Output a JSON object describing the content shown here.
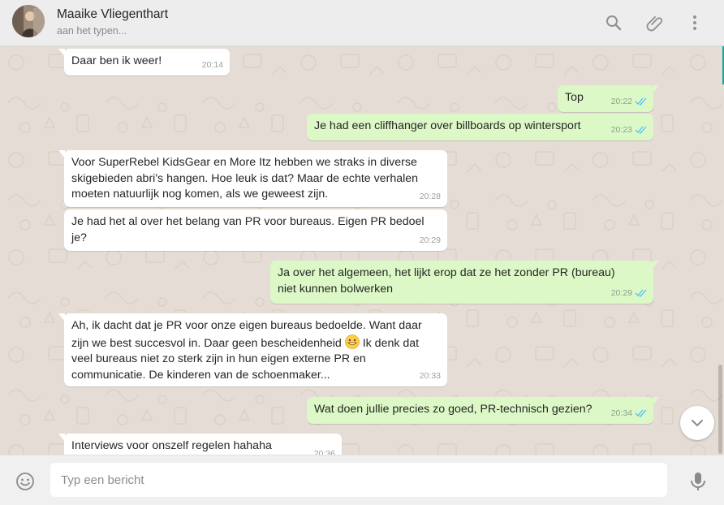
{
  "header": {
    "contact_name": "Maaike Vliegenthart",
    "contact_status": "aan het typen..."
  },
  "messages": [
    {
      "direction": "in",
      "text": "Daar ben ik weer!",
      "time": "20:14"
    },
    {
      "direction": "out",
      "text": "Top",
      "time": "20:22",
      "status": "read"
    },
    {
      "direction": "out",
      "text": "Je had een cliffhanger over billboards op wintersport",
      "time": "20:23",
      "status": "read"
    },
    {
      "direction": "in",
      "text": "Voor SuperRebel KidsGear en More Itz hebben we straks in diverse skigebieden abri's hangen. Hoe leuk is dat? Maar de echte verhalen moeten natuurlijk nog komen, als we geweest zijn.",
      "time": "20:28"
    },
    {
      "direction": "in",
      "text": "Je had het al over het belang van PR voor bureaus. Eigen PR bedoel je?",
      "time": "20:29"
    },
    {
      "direction": "out",
      "text": "Ja over het algemeen, het lijkt erop dat ze het zonder PR (bureau) niet kunnen bolwerken",
      "time": "20:29",
      "status": "read"
    },
    {
      "direction": "in",
      "text_before_emoji": "Ah, ik dacht dat je PR voor onze eigen bureaus bedoelde. Want daar zijn we best succesvol in. Daar geen bescheidenheid ",
      "emoji": "grinning-face-emoji",
      "text_after_emoji": " Ik denk dat veel bureaus niet zo sterk zijn in hun eigen externe PR en communicatie. De kinderen van de schoenmaker...",
      "time": "20:33"
    },
    {
      "direction": "out",
      "text": "Wat doen jullie precies zo goed, PR-technisch gezien?",
      "time": "20:34",
      "status": "read"
    },
    {
      "direction": "in",
      "text": "Interviews voor onszelf regelen hahaha",
      "time": "20:36"
    }
  ],
  "composer": {
    "placeholder": "Typ een bericht",
    "value": ""
  },
  "icons": {
    "search": "search-icon",
    "attach": "paperclip-icon",
    "menu": "more-vertical-icon",
    "emoji": "smiley-icon",
    "mic": "microphone-icon",
    "scroll": "chevron-down-icon"
  },
  "colors": {
    "chat_background": "#e5ddd5",
    "incoming_bubble": "#ffffff",
    "outgoing_bubble": "#dcf8c6",
    "read_tick": "#4fc3f7",
    "accent": "#1aa897"
  }
}
